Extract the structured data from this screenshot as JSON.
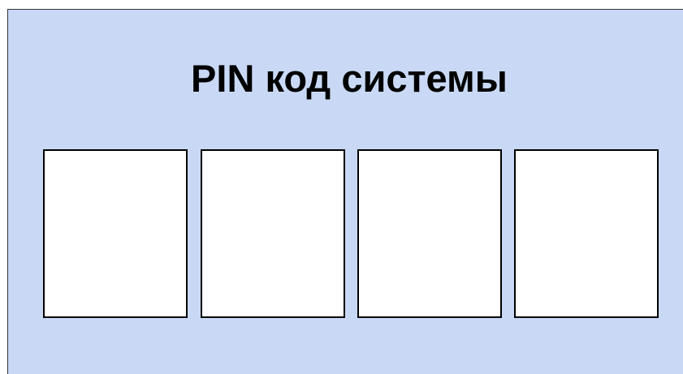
{
  "pin_dialog": {
    "title": "PIN код системы",
    "digits": [
      "",
      "",
      "",
      ""
    ]
  },
  "colors": {
    "panel_background": "#c9d9f5",
    "box_background": "#ffffff",
    "border": "#000000"
  }
}
